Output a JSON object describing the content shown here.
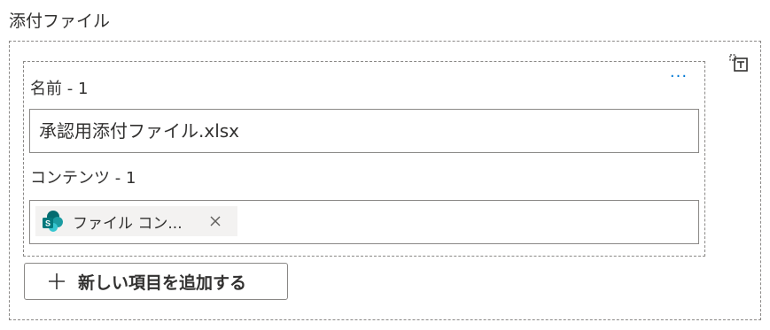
{
  "section": {
    "title": "添付ファイル"
  },
  "item": {
    "name_label": "名前 - 1",
    "more_label": "···",
    "name_value": "承認用添付ファイル.xlsx",
    "content_label": "コンテンツ - 1",
    "token_text": "ファイル コン...",
    "token_remove_label": "✕"
  },
  "add_button": {
    "label": "新しい項目を追加する"
  },
  "icons": {
    "token_icon": "sharepoint-icon",
    "add_icon": "plus-icon",
    "remove_array_icon": "delete-array-icon"
  },
  "colors": {
    "accent": "#0078d4",
    "sharepoint_dark": "#036c70",
    "sharepoint_mid": "#1a9ba1",
    "sharepoint_light": "#37c6d0",
    "border": "#8a8886",
    "text": "#323130"
  }
}
